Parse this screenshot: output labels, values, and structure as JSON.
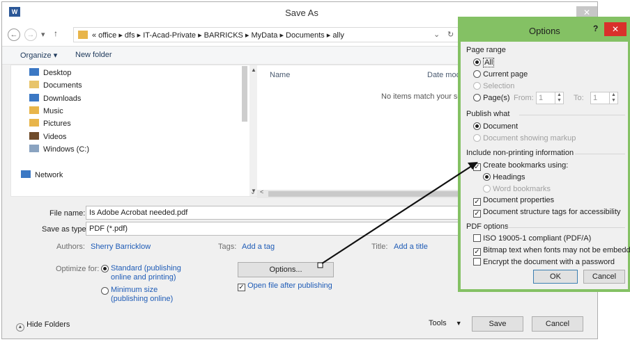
{
  "window": {
    "title": "Save As",
    "app_icon": "W",
    "close_label": "✕"
  },
  "address": {
    "back": "←",
    "forward": "→",
    "down": "▾",
    "up": "↑",
    "path": "« office ▸ dfs ▸ IT-Acad-Private ▸ BARRICKS ▸ MyData ▸ Documents ▸ ally",
    "dropdown": "⌄",
    "refresh": "↻"
  },
  "toolbar": {
    "organize": "Organize ▾",
    "new_folder": "New folder"
  },
  "nav": {
    "items": [
      {
        "label": "Desktop",
        "icon": "desktop-icon"
      },
      {
        "label": "Documents",
        "icon": "documents-icon"
      },
      {
        "label": "Downloads",
        "icon": "downloads-icon"
      },
      {
        "label": "Music",
        "icon": "music-icon"
      },
      {
        "label": "Pictures",
        "icon": "pictures-icon"
      },
      {
        "label": "Videos",
        "icon": "videos-icon"
      },
      {
        "label": "Windows (C:)",
        "icon": "drive-icon"
      }
    ],
    "network": "Network"
  },
  "files": {
    "col_name": "Name",
    "col_date": "Date mod",
    "empty_message": "No items match your sea"
  },
  "form": {
    "file_name_label": "File name:",
    "file_name_value": "Is Adobe Acrobat needed.pdf",
    "save_type_label": "Save as type:",
    "save_type_value": "PDF (*.pdf)",
    "authors_label": "Authors:",
    "authors_value": "Sherry Barricklow",
    "tags_label": "Tags:",
    "tags_value": "Add a tag",
    "title_label": "Title:",
    "title_value": "Add a title",
    "optimize_label": "Optimize for:",
    "optimize_standard_1": "Standard (publishing",
    "optimize_standard_2": "online and printing)",
    "optimize_min_1": "Minimum size",
    "optimize_min_2": "(publishing online)",
    "options_button": "Options...",
    "open_after_label": "Open file after publishing"
  },
  "footer": {
    "hide_folders": "Hide Folders",
    "tools": "Tools",
    "save": "Save",
    "cancel": "Cancel"
  },
  "options": {
    "title": "Options",
    "help": "?",
    "close": "✕",
    "page_range": "Page range",
    "all": "All",
    "current_page": "Current page",
    "selection": "Selection",
    "pages": "Page(s)",
    "from": "From:",
    "from_value": "1",
    "to": "To:",
    "to_value": "1",
    "publish_what": "Publish what",
    "document": "Document",
    "document_markup": "Document showing markup",
    "include_nonprinting": "Include non-printing information",
    "create_bookmarks": "Create bookmarks using:",
    "headings": "Headings",
    "word_bookmarks": "Word bookmarks",
    "document_properties": "Document properties",
    "structure_tags": "Document structure tags for accessibility",
    "pdf_options": "PDF options",
    "iso": "ISO 19005-1 compliant (PDF/A)",
    "bitmap_text": "Bitmap text when fonts may not be embedded",
    "encrypt": "Encrypt the document with a password",
    "ok": "OK",
    "cancel": "Cancel"
  },
  "colors": {
    "dialog_border": "#84c164",
    "close_red": "#d9302b",
    "link": "#1e5bb6",
    "arrow": "#111111"
  }
}
